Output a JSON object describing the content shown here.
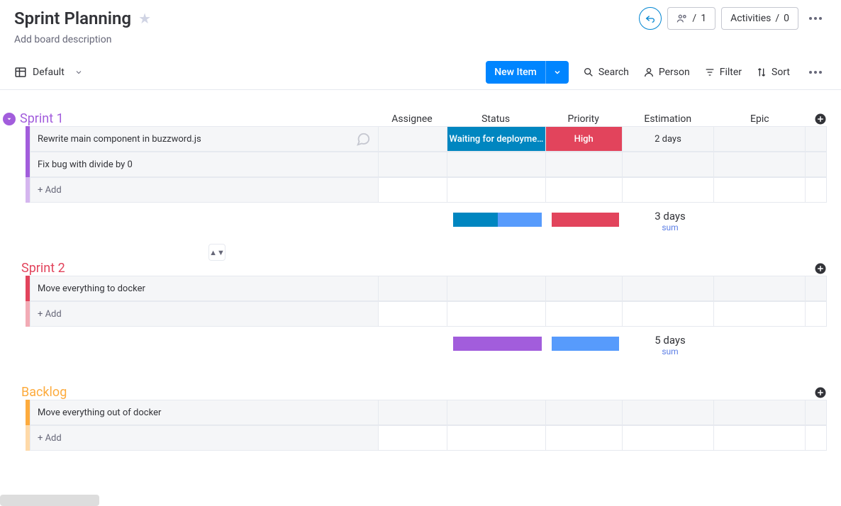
{
  "header": {
    "title": "Sprint Planning",
    "description_placeholder": "Add board description",
    "people_count": "1",
    "activities_label": "Activities",
    "activities_count": "0"
  },
  "toolbar": {
    "view_name": "Default",
    "new_item": "New Item",
    "search": "Search",
    "person": "Person",
    "filter": "Filter",
    "sort": "Sort"
  },
  "columns": {
    "assignee": "Assignee",
    "status": "Status",
    "priority": "Priority",
    "estimation": "Estimation",
    "epic": "Epic"
  },
  "colors": {
    "sprint1": "#a25ddc",
    "sprint2": "#e2445c",
    "backlog": "#fdab3d",
    "status_waiting": "#0086c0",
    "status_blue": "#579bfc",
    "priority_high": "#e2445c",
    "sum_purple": "#a25ddc",
    "sum_blue": "#579bfc"
  },
  "groups": [
    {
      "id": "sprint1",
      "name": "Sprint 1",
      "color_key": "sprint1",
      "show_toggle": true,
      "items": [
        {
          "name": "Rewrite main component in buzzword.js",
          "status": "Waiting for deployme…",
          "status_color": "status_waiting",
          "priority": "High",
          "priority_color": "priority_high",
          "estimation": "2 days",
          "has_chat": true
        },
        {
          "name": "Fix bug with divide by 0"
        }
      ],
      "add_label": "+ Add",
      "summary": {
        "status_segments": [
          {
            "color": "status_waiting",
            "flex": 1
          },
          {
            "color": "status_blue",
            "flex": 1
          }
        ],
        "priority_segments": [
          {
            "color": "priority_high",
            "flex": 1
          }
        ],
        "estimation": "3 days",
        "estimation_sub": "sum"
      }
    },
    {
      "id": "sprint2",
      "name": "Sprint 2",
      "color_key": "sprint2",
      "show_drag_above": true,
      "items": [
        {
          "name": "Move everything to docker"
        }
      ],
      "add_label": "+ Add",
      "summary": {
        "status_segments": [
          {
            "color": "sum_purple",
            "flex": 1
          }
        ],
        "priority_segments": [
          {
            "color": "sum_blue",
            "flex": 1
          }
        ],
        "estimation": "5 days",
        "estimation_sub": "sum"
      }
    },
    {
      "id": "backlog",
      "name": "Backlog",
      "color_key": "backlog",
      "items": [
        {
          "name": "Move everything out of docker"
        }
      ],
      "add_label": "+ Add"
    }
  ]
}
